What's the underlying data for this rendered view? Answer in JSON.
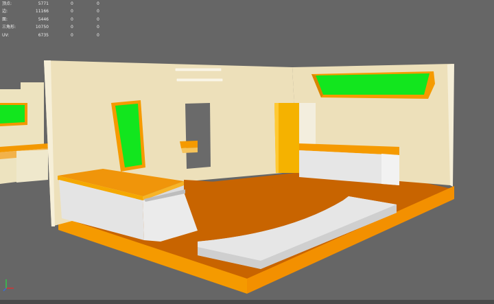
{
  "stats": {
    "rows": [
      {
        "label": "顶点:",
        "value": "5771",
        "selected": "0",
        "uv_selected": "0"
      },
      {
        "label": "边:",
        "value": "11166",
        "selected": "0",
        "uv_selected": "0"
      },
      {
        "label": "面:",
        "value": "5446",
        "selected": "0",
        "uv_selected": "0"
      },
      {
        "label": "三角形:",
        "value": "10750",
        "selected": "0",
        "uv_selected": "0"
      },
      {
        "label": "UV:",
        "value": "6735",
        "selected": "0",
        "uv_selected": "0"
      }
    ]
  },
  "colors": {
    "background": "#666666",
    "wall": "#ede0ba",
    "floor": "#c86400",
    "trim": "#f59a00",
    "counter_top": "#f0950a",
    "counter_front": "#e4e4e4",
    "screen": "#12e61e"
  },
  "icons": {
    "axis": "xyz-axis-icon"
  }
}
